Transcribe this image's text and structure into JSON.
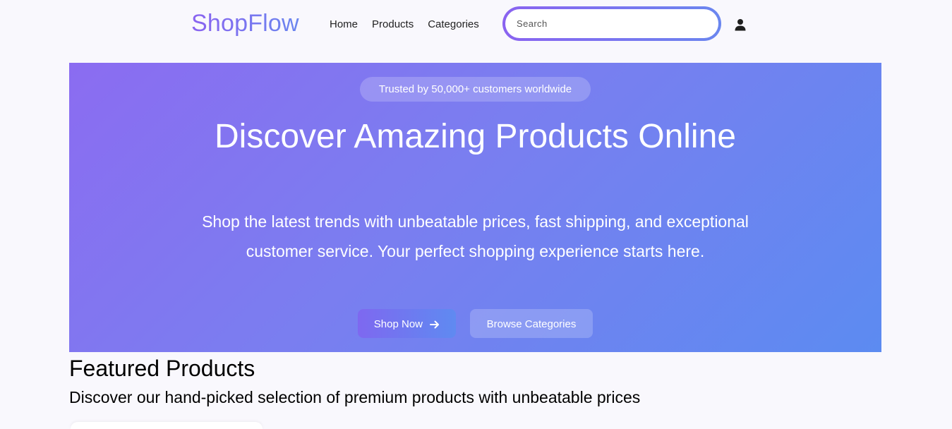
{
  "header": {
    "logo": "ShopFlow",
    "nav": [
      "Home",
      "Products",
      "Categories"
    ],
    "search_placeholder": "Search",
    "user_icon": "user-icon"
  },
  "hero": {
    "badge": "Trusted by 50,000+ customers worldwide",
    "title": "Discover Amazing Products Online",
    "subtitle": "Shop the latest trends with unbeatable prices, fast shipping, and exceptional customer service. Your perfect shopping experience starts here.",
    "shop_now_label": "Shop Now",
    "browse_label": "Browse Categories",
    "gradient_start": "#8b6cf1",
    "gradient_end": "#5c8bf1"
  },
  "featured": {
    "title": "Featured Products",
    "subtitle": "Discover our hand-picked selection of premium products with unbeatable prices"
  }
}
